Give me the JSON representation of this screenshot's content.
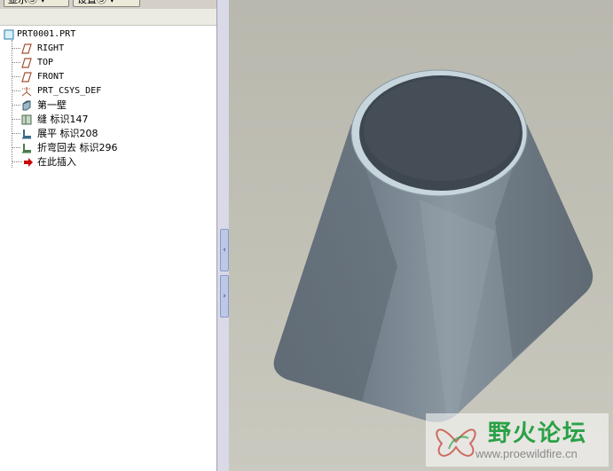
{
  "toolbar": {
    "show_label": "显示Ⓢ ▾",
    "settings_label": "设置Ⓢ ▾"
  },
  "model_tree": {
    "root": "PRT0001.PRT",
    "items": [
      {
        "label": "RIGHT",
        "icon": "datum-plane-icon"
      },
      {
        "label": "TOP",
        "icon": "datum-plane-icon"
      },
      {
        "label": "FRONT",
        "icon": "datum-plane-icon"
      },
      {
        "label": "PRT_CSYS_DEF",
        "icon": "coordinate-system-icon"
      },
      {
        "label": "第一壁",
        "icon": "first-wall-icon"
      },
      {
        "label": "缝 标识147",
        "icon": "rip-icon"
      },
      {
        "label": "展平 标识208",
        "icon": "unbend-icon"
      },
      {
        "label": "折弯回去 标识296",
        "icon": "bend-back-icon"
      },
      {
        "label": "在此插入",
        "icon": "insert-here-arrow-icon"
      }
    ]
  },
  "splitter": {
    "collapse_glyph": "‹",
    "expand_glyph": "›"
  },
  "watermark": {
    "title": "野火论坛",
    "url": "www.proewildfire.cn"
  },
  "colors": {
    "insert_arrow": "#cc0000",
    "datum_plane": "#a0522d",
    "viewport_bg": "#c1c0b5",
    "model_surface": "#7b8793",
    "watermark_green": "#2aa146"
  }
}
